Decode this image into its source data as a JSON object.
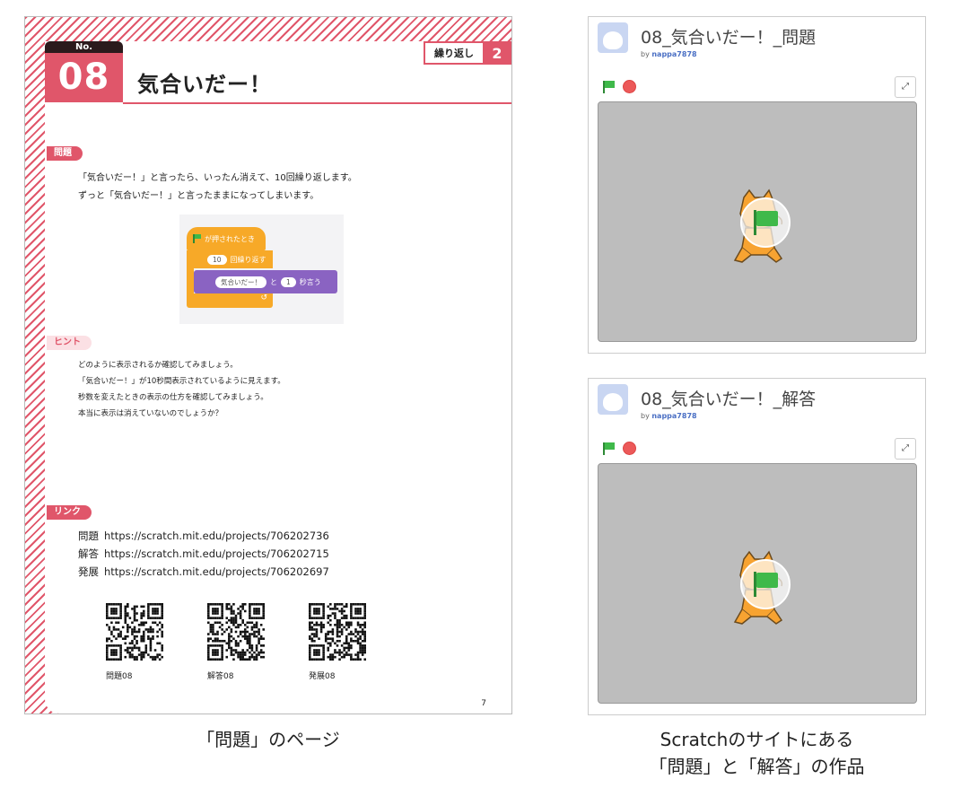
{
  "book": {
    "chapter_name": "繰り返し",
    "chapter_number": "2",
    "no_label": "No.",
    "number": "08",
    "title": "気合いだー！",
    "problem_tag": "問題",
    "problem_lines": [
      "「気合いだー！」と言ったら、いったん消えて、10回繰り返します。",
      "ずっと「気合いだー！」と言ったままになってしまいます。"
    ],
    "blocks": {
      "hat": "が押されたとき",
      "repeat_count": "10",
      "repeat_label": "回繰り返す",
      "say_text": "気合いだー！",
      "say_and": "と",
      "say_secs": "1",
      "say_label": "秒言う",
      "repeat_arrow": "↺"
    },
    "hint_tag": "ヒント",
    "hint_lines": [
      "どのように表示されるか確認してみましょう。",
      "「気合いだー！」が10秒間表示されているように見えます。",
      "秒数を変えたときの表示の仕方を確認してみましょう。",
      "本当に表示は消えていないのでしょうか？"
    ],
    "link_tag": "リンク",
    "links": [
      {
        "key": "問題",
        "url": "https://scratch.mit.edu/projects/706202736"
      },
      {
        "key": "解答",
        "url": "https://scratch.mit.edu/projects/706202715"
      },
      {
        "key": "発展",
        "url": "https://scratch.mit.edu/projects/706202697"
      }
    ],
    "qr_captions": [
      "問題08",
      "解答08",
      "発展08"
    ],
    "page_number": "7"
  },
  "captions": {
    "left": "「問題」のページ",
    "right_line1": "Scratchのサイトにある",
    "right_line2": "「問題」と「解答」の作品"
  },
  "players": [
    {
      "title": "08_気合いだー！_問題",
      "by": "by",
      "author": "nappa7878"
    },
    {
      "title": "08_気合いだー！_解答",
      "by": "by",
      "author": "nappa7878"
    }
  ],
  "icons": {
    "green_flag": "green-flag-icon",
    "stop": "stop-icon",
    "fullscreen": "fullscreen-icon",
    "fullscreen_glyph": "⤢"
  },
  "colors": {
    "accent": "#e0566a",
    "event_block": "#f7a928",
    "looks_block": "#8a63c2",
    "stage": "#bdbdbd"
  }
}
